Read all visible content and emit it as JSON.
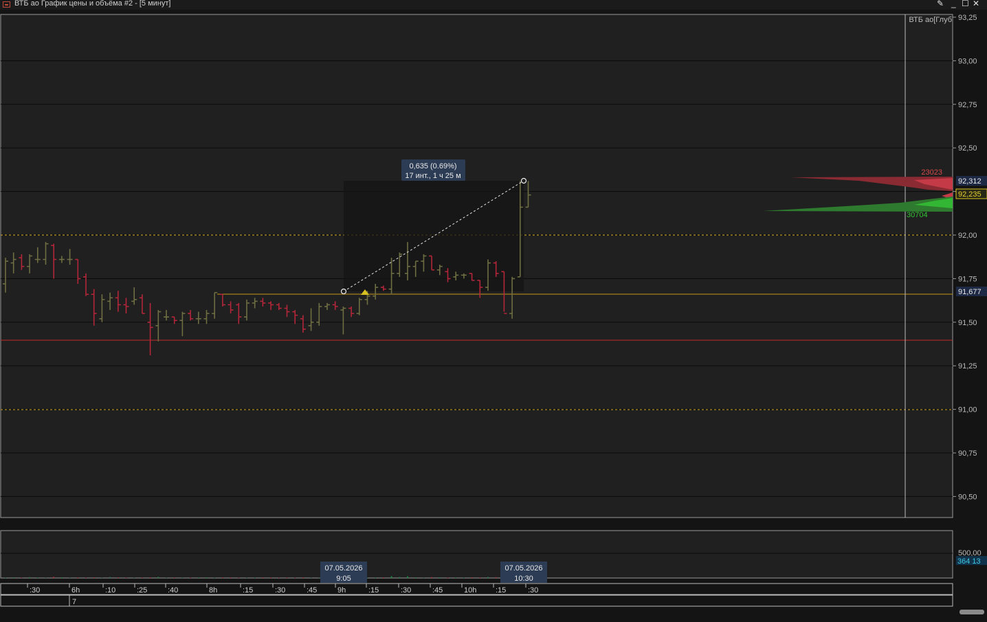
{
  "window": {
    "title": "ВТБ ао График цены и объёма #2 - [5 минут]",
    "pin_icon": "pin-icon",
    "minimize_icon": "minimize-icon",
    "maximize_icon": "maximize-icon",
    "close_icon": "close-icon"
  },
  "chart": {
    "depth_label": "ВТБ ао[Глуб",
    "ruler_change": "0,635 (0.69%)",
    "ruler_span": "17 инт., 1 ч 25 м",
    "depth_ask_volume": "23023",
    "depth_bid_volume": "30704",
    "price_tags": {
      "ask": "92,312",
      "last": "92,235",
      "level": "91,677"
    },
    "volume_axis_label": "500,00",
    "volume_current": "364 13",
    "crosshair_date_left": "07.05.2026",
    "crosshair_time_left": "9:05",
    "crosshair_date_right": "07.05.2026",
    "crosshair_time_right": "10:30",
    "time_row2_label": "7",
    "colors": {
      "bull": "#6e6e42",
      "bear": "#b3263a",
      "bid": "#33b633",
      "ask": "#c43b47",
      "accent": "#d8c022"
    }
  },
  "chart_data": {
    "type": "ohlc",
    "y_ticks": [
      "93,25",
      "93,00",
      "92,75",
      "92,50",
      "92,25",
      "92,00",
      "91,75",
      "91,50",
      "91,25",
      "91,00",
      "90,75",
      "90,50"
    ],
    "ylim": [
      90.4,
      93.25
    ],
    "x_ticks": [
      ":30",
      "6h",
      ":10",
      ":25",
      ":40",
      "8h",
      ":15",
      ":30",
      ":45",
      "9h",
      ":15",
      ":30",
      ":45",
      "10h",
      ":15",
      ":30"
    ],
    "bars": [
      {
        "o": 91.72,
        "h": 91.87,
        "l": 91.67,
        "c": 91.85
      },
      {
        "o": 91.84,
        "h": 91.9,
        "l": 91.78,
        "c": 91.86
      },
      {
        "o": 91.87,
        "h": 91.89,
        "l": 91.8,
        "c": 91.82
      },
      {
        "o": 91.82,
        "h": 91.89,
        "l": 91.78,
        "c": 91.88
      },
      {
        "o": 91.86,
        "h": 91.93,
        "l": 91.84,
        "c": 91.86
      },
      {
        "o": 91.86,
        "h": 91.96,
        "l": 91.83,
        "c": 91.95
      },
      {
        "o": 91.94,
        "h": 91.95,
        "l": 91.75,
        "c": 91.86
      },
      {
        "o": 91.86,
        "h": 91.88,
        "l": 91.84,
        "c": 91.86
      },
      {
        "o": 91.86,
        "h": 91.92,
        "l": 91.83,
        "c": 91.86
      },
      {
        "o": 91.86,
        "h": 91.86,
        "l": 91.72,
        "c": 91.75
      },
      {
        "o": 91.76,
        "h": 91.78,
        "l": 91.65,
        "c": 91.66
      },
      {
        "o": 91.66,
        "h": 91.69,
        "l": 91.48,
        "c": 91.55
      },
      {
        "o": 91.52,
        "h": 91.66,
        "l": 91.5,
        "c": 91.63
      },
      {
        "o": 91.62,
        "h": 91.67,
        "l": 91.57,
        "c": 91.64
      },
      {
        "o": 91.64,
        "h": 91.68,
        "l": 91.56,
        "c": 91.6
      },
      {
        "o": 91.6,
        "h": 91.64,
        "l": 91.55,
        "c": 91.59
      },
      {
        "o": 91.62,
        "h": 91.7,
        "l": 91.6,
        "c": 91.63
      },
      {
        "o": 91.64,
        "h": 91.66,
        "l": 91.55,
        "c": 91.55
      },
      {
        "o": 91.5,
        "h": 91.61,
        "l": 91.31,
        "c": 91.47
      },
      {
        "o": 91.48,
        "h": 91.57,
        "l": 91.39,
        "c": 91.56
      },
      {
        "o": 91.53,
        "h": 91.57,
        "l": 91.51,
        "c": 91.53
      },
      {
        "o": 91.53,
        "h": 91.53,
        "l": 91.49,
        "c": 91.51
      },
      {
        "o": 91.51,
        "h": 91.56,
        "l": 91.42,
        "c": 91.55
      },
      {
        "o": 91.55,
        "h": 91.57,
        "l": 91.51,
        "c": 91.52
      },
      {
        "o": 91.52,
        "h": 91.56,
        "l": 91.49,
        "c": 91.52
      },
      {
        "o": 91.52,
        "h": 91.57,
        "l": 91.49,
        "c": 91.55
      },
      {
        "o": 91.55,
        "h": 91.67,
        "l": 91.52,
        "c": 91.67
      },
      {
        "o": 91.66,
        "h": 91.66,
        "l": 91.59,
        "c": 91.6
      },
      {
        "o": 91.6,
        "h": 91.62,
        "l": 91.55,
        "c": 91.57
      },
      {
        "o": 91.6,
        "h": 91.61,
        "l": 91.49,
        "c": 91.53
      },
      {
        "o": 91.53,
        "h": 91.63,
        "l": 91.51,
        "c": 91.61
      },
      {
        "o": 91.61,
        "h": 91.64,
        "l": 91.58,
        "c": 91.62
      },
      {
        "o": 91.62,
        "h": 91.64,
        "l": 91.59,
        "c": 91.61
      },
      {
        "o": 91.61,
        "h": 91.62,
        "l": 91.57,
        "c": 91.6
      },
      {
        "o": 91.6,
        "h": 91.61,
        "l": 91.57,
        "c": 91.58
      },
      {
        "o": 91.58,
        "h": 91.6,
        "l": 91.53,
        "c": 91.56
      },
      {
        "o": 91.56,
        "h": 91.57,
        "l": 91.49,
        "c": 91.54
      },
      {
        "o": 91.52,
        "h": 91.54,
        "l": 91.44,
        "c": 91.46
      },
      {
        "o": 91.48,
        "h": 91.58,
        "l": 91.45,
        "c": 91.5
      },
      {
        "o": 91.5,
        "h": 91.61,
        "l": 91.48,
        "c": 91.59
      },
      {
        "o": 91.59,
        "h": 91.61,
        "l": 91.57,
        "c": 91.6
      },
      {
        "o": 91.6,
        "h": 91.62,
        "l": 91.57,
        "c": 91.59
      },
      {
        "o": 91.57,
        "h": 91.59,
        "l": 91.43,
        "c": 91.58
      },
      {
        "o": 91.58,
        "h": 91.59,
        "l": 91.53,
        "c": 91.55
      },
      {
        "o": 91.55,
        "h": 91.64,
        "l": 91.54,
        "c": 91.63
      },
      {
        "o": 91.63,
        "h": 91.68,
        "l": 91.6,
        "c": 91.65
      },
      {
        "o": 91.65,
        "h": 91.72,
        "l": 91.63,
        "c": 91.7
      },
      {
        "o": 91.7,
        "h": 91.71,
        "l": 91.68,
        "c": 91.69
      },
      {
        "o": 91.69,
        "h": 91.87,
        "l": 91.66,
        "c": 91.78
      },
      {
        "o": 91.78,
        "h": 91.9,
        "l": 91.76,
        "c": 91.89
      },
      {
        "o": 91.78,
        "h": 91.96,
        "l": 91.74,
        "c": 91.82
      },
      {
        "o": 91.82,
        "h": 91.85,
        "l": 91.76,
        "c": 91.85
      },
      {
        "o": 91.85,
        "h": 91.89,
        "l": 91.79,
        "c": 91.88
      },
      {
        "o": 91.88,
        "h": 91.88,
        "l": 91.8,
        "c": 91.8
      },
      {
        "o": 91.8,
        "h": 91.83,
        "l": 91.77,
        "c": 91.82
      },
      {
        "o": 91.79,
        "h": 91.81,
        "l": 91.73,
        "c": 91.75
      },
      {
        "o": 91.76,
        "h": 91.79,
        "l": 91.74,
        "c": 91.77
      },
      {
        "o": 91.77,
        "h": 91.78,
        "l": 91.75,
        "c": 91.77
      },
      {
        "o": 91.78,
        "h": 91.78,
        "l": 91.74,
        "c": 91.74
      },
      {
        "o": 91.74,
        "h": 91.74,
        "l": 91.64,
        "c": 91.7
      },
      {
        "o": 91.7,
        "h": 91.86,
        "l": 91.68,
        "c": 91.84
      },
      {
        "o": 91.84,
        "h": 91.85,
        "l": 91.76,
        "c": 91.78
      },
      {
        "o": 91.79,
        "h": 91.79,
        "l": 91.56,
        "c": 91.55
      },
      {
        "o": 91.55,
        "h": 91.76,
        "l": 91.52,
        "c": 91.75
      },
      {
        "o": 91.76,
        "h": 92.31,
        "l": 91.76,
        "c": 92.16
      },
      {
        "o": 92.16,
        "h": 92.31,
        "l": 92.16,
        "c": 92.23
      }
    ],
    "volume": [
      6,
      10,
      7,
      13,
      8,
      4,
      19,
      12,
      5,
      9,
      7,
      12,
      5,
      15,
      10,
      7,
      6,
      8,
      10,
      18,
      4,
      9,
      7,
      6,
      8,
      12,
      6,
      9,
      10,
      6,
      5,
      7,
      10,
      9,
      7,
      8,
      6,
      10,
      5,
      6,
      9,
      7,
      8,
      12,
      10,
      6,
      8,
      10,
      30,
      15,
      28,
      10,
      7,
      14,
      12,
      8,
      9,
      7,
      11,
      9,
      16,
      13,
      6,
      19,
      71,
      30
    ],
    "volume_ylim": [
      0,
      750
    ]
  }
}
